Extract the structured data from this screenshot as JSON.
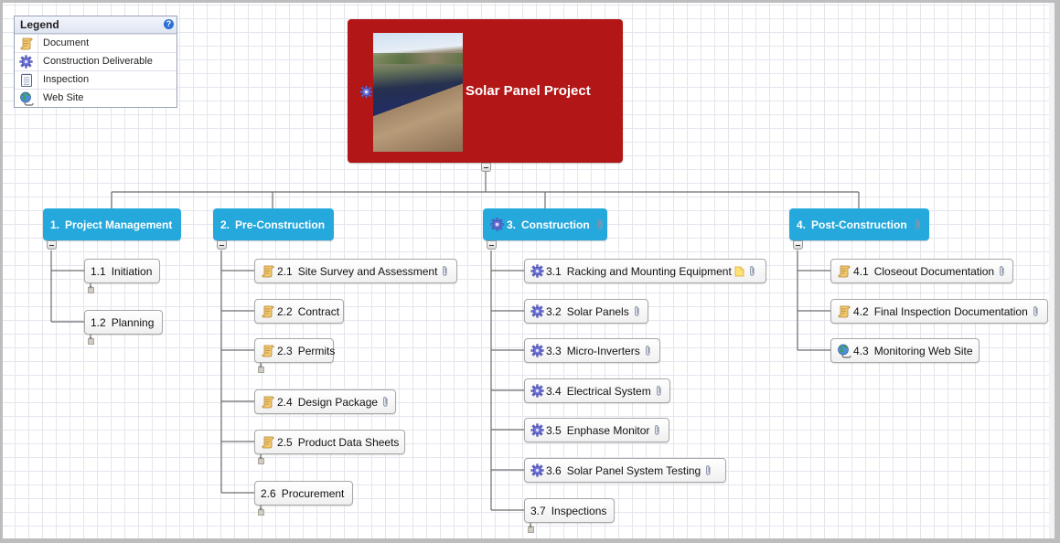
{
  "legend": {
    "title": "Legend",
    "help_icon": "help-icon",
    "items": [
      {
        "icon": "document-icon",
        "label": "Document"
      },
      {
        "icon": "gear-icon",
        "label": "Construction Deliverable"
      },
      {
        "icon": "notepad-icon",
        "label": "Inspection"
      },
      {
        "icon": "globe-icon",
        "label": "Web Site"
      }
    ]
  },
  "root": {
    "title": "Solar Panel Project",
    "icon": "gear-icon",
    "image": "solar-roof-photo",
    "color": "#b31616"
  },
  "colors": {
    "level1": "#25a8dc",
    "canvas": "#ffffff",
    "grid": "#e4e6ee"
  },
  "branches": [
    {
      "num": "1.",
      "label": "Project Management",
      "icon": null,
      "attachment": false,
      "children": [
        {
          "num": "1.1",
          "label": "Initiation",
          "icon": null,
          "attachment": false,
          "note": false,
          "collapsed": true
        },
        {
          "num": "1.2",
          "label": "Planning",
          "icon": null,
          "attachment": false,
          "note": false,
          "collapsed": true
        }
      ]
    },
    {
      "num": "2.",
      "label": "Pre-Construction",
      "icon": null,
      "attachment": false,
      "children": [
        {
          "num": "2.1",
          "label": "Site Survey and Assessment",
          "icon": "document-icon",
          "attachment": true,
          "note": false,
          "collapsed": false
        },
        {
          "num": "2.2",
          "label": "Contract",
          "icon": "document-icon",
          "attachment": false,
          "note": false,
          "collapsed": false
        },
        {
          "num": "2.3",
          "label": "Permits",
          "icon": "document-icon",
          "attachment": false,
          "note": false,
          "collapsed": true
        },
        {
          "num": "2.4",
          "label": "Design Package",
          "icon": "document-icon",
          "attachment": true,
          "note": false,
          "collapsed": false
        },
        {
          "num": "2.5",
          "label": "Product Data Sheets",
          "icon": "document-icon",
          "attachment": false,
          "note": false,
          "collapsed": true
        },
        {
          "num": "2.6",
          "label": "Procurement",
          "icon": null,
          "attachment": false,
          "note": false,
          "collapsed": true
        }
      ]
    },
    {
      "num": "3.",
      "label": "Construction",
      "icon": "gear-icon",
      "attachment": true,
      "children": [
        {
          "num": "3.1",
          "label": "Racking and Mounting Equipment",
          "icon": "gear-icon",
          "attachment": true,
          "note": true,
          "collapsed": false
        },
        {
          "num": "3.2",
          "label": "Solar Panels",
          "icon": "gear-icon",
          "attachment": true,
          "note": false,
          "collapsed": false
        },
        {
          "num": "3.3",
          "label": "Micro-Inverters",
          "icon": "gear-icon",
          "attachment": true,
          "note": false,
          "collapsed": false
        },
        {
          "num": "3.4",
          "label": "Electrical System",
          "icon": "gear-icon",
          "attachment": true,
          "note": false,
          "collapsed": false
        },
        {
          "num": "3.5",
          "label": "Enphase Monitor",
          "icon": "gear-icon",
          "attachment": true,
          "note": false,
          "collapsed": false
        },
        {
          "num": "3.6",
          "label": "Solar Panel System Testing",
          "icon": "gear-icon",
          "attachment": true,
          "note": false,
          "collapsed": false
        },
        {
          "num": "3.7",
          "label": "Inspections",
          "icon": null,
          "attachment": false,
          "note": false,
          "collapsed": true
        }
      ]
    },
    {
      "num": "4.",
      "label": "Post-Construction",
      "icon": null,
      "attachment": true,
      "children": [
        {
          "num": "4.1",
          "label": "Closeout Documentation",
          "icon": "document-icon",
          "attachment": true,
          "note": false,
          "collapsed": false
        },
        {
          "num": "4.2",
          "label": "Final Inspection Documentation",
          "icon": "document-icon",
          "attachment": true,
          "note": false,
          "collapsed": false
        },
        {
          "num": "4.3",
          "label": "Monitoring Web Site",
          "icon": "globe-icon",
          "attachment": false,
          "note": false,
          "collapsed": false
        }
      ]
    }
  ]
}
